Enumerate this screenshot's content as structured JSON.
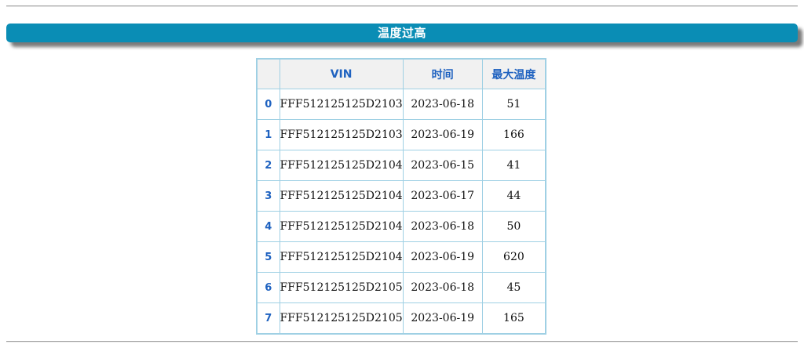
{
  "banner": {
    "title": "温度过高"
  },
  "table": {
    "columns": [
      "",
      "VIN",
      "时间",
      "最大温度"
    ],
    "rows": [
      {
        "index": "0",
        "vin": "FFF512125125D2103",
        "date": "2023-06-18",
        "max_temp": "51"
      },
      {
        "index": "1",
        "vin": "FFF512125125D2103",
        "date": "2023-06-19",
        "max_temp": "166"
      },
      {
        "index": "2",
        "vin": "FFF512125125D2104",
        "date": "2023-06-15",
        "max_temp": "41"
      },
      {
        "index": "3",
        "vin": "FFF512125125D2104",
        "date": "2023-06-17",
        "max_temp": "44"
      },
      {
        "index": "4",
        "vin": "FFF512125125D2104",
        "date": "2023-06-18",
        "max_temp": "50"
      },
      {
        "index": "5",
        "vin": "FFF512125125D2104",
        "date": "2023-06-19",
        "max_temp": "620"
      },
      {
        "index": "6",
        "vin": "FFF512125125D2105",
        "date": "2023-06-18",
        "max_temp": "45"
      },
      {
        "index": "7",
        "vin": "FFF512125125D2105",
        "date": "2023-06-19",
        "max_temp": "165"
      }
    ]
  },
  "colors": {
    "banner_bg": "#0a8db5",
    "header_text": "#1f62c0",
    "border": "#9fd0e4"
  }
}
